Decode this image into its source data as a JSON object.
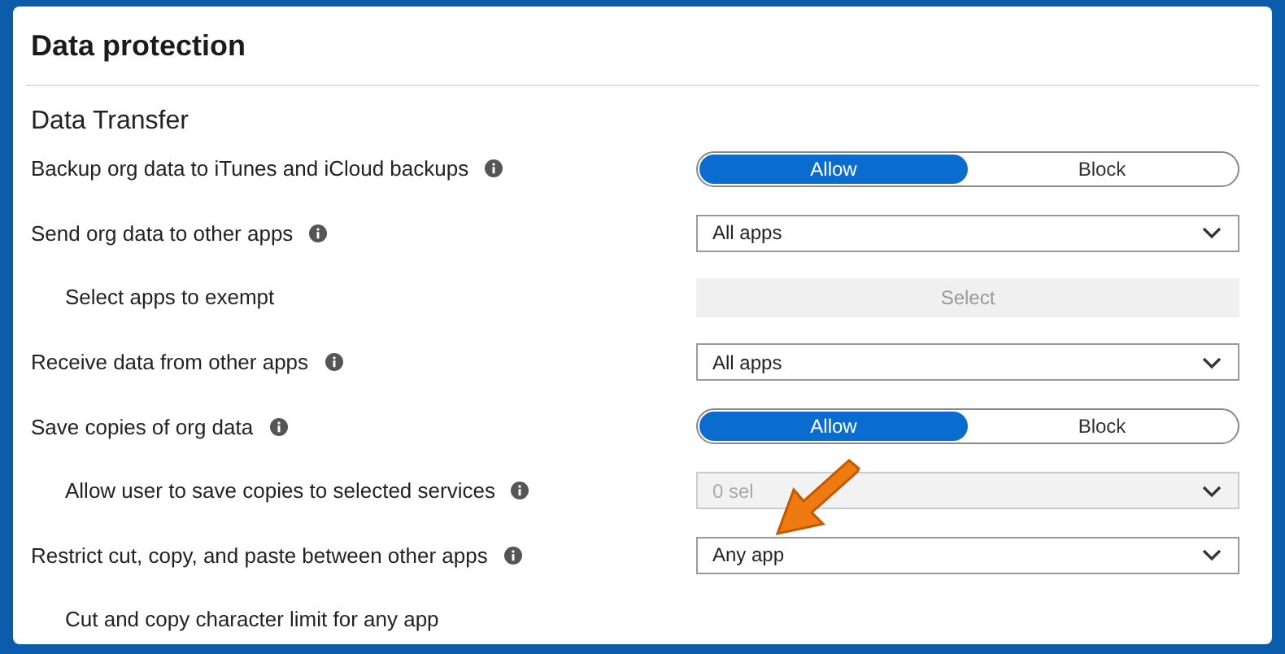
{
  "panel": {
    "title": "Data protection"
  },
  "section": {
    "title": "Data Transfer"
  },
  "settings": [
    {
      "label": "Backup org data to iTunes and iCloud backups",
      "info": true,
      "indented": false,
      "kind": "toggle",
      "options": [
        {
          "label": "Allow",
          "selected": true
        },
        {
          "label": "Block",
          "selected": false
        }
      ]
    },
    {
      "label": "Send org data to other apps",
      "info": true,
      "indented": false,
      "kind": "dropdown",
      "value": "All apps",
      "disabled": false
    },
    {
      "label": "Select apps to exempt",
      "info": false,
      "indented": true,
      "kind": "button",
      "button": "Select",
      "disabled": true
    },
    {
      "label": "Receive data from other apps",
      "info": true,
      "indented": false,
      "kind": "dropdown",
      "value": "All apps",
      "disabled": false
    },
    {
      "label": "Save copies of org data",
      "info": true,
      "indented": false,
      "kind": "toggle",
      "options": [
        {
          "label": "Allow",
          "selected": true
        },
        {
          "label": "Block",
          "selected": false
        }
      ]
    },
    {
      "label": "Allow user to save copies to selected services",
      "info": true,
      "indented": true,
      "kind": "dropdown",
      "value": "0 sel",
      "disabled": true
    },
    {
      "label": "Restrict cut, copy, and paste between other apps",
      "info": true,
      "indented": false,
      "kind": "dropdown",
      "value": "Any app",
      "disabled": false
    },
    {
      "label": "Cut and copy character limit for any app",
      "info": false,
      "indented": true,
      "kind": "none"
    }
  ]
}
